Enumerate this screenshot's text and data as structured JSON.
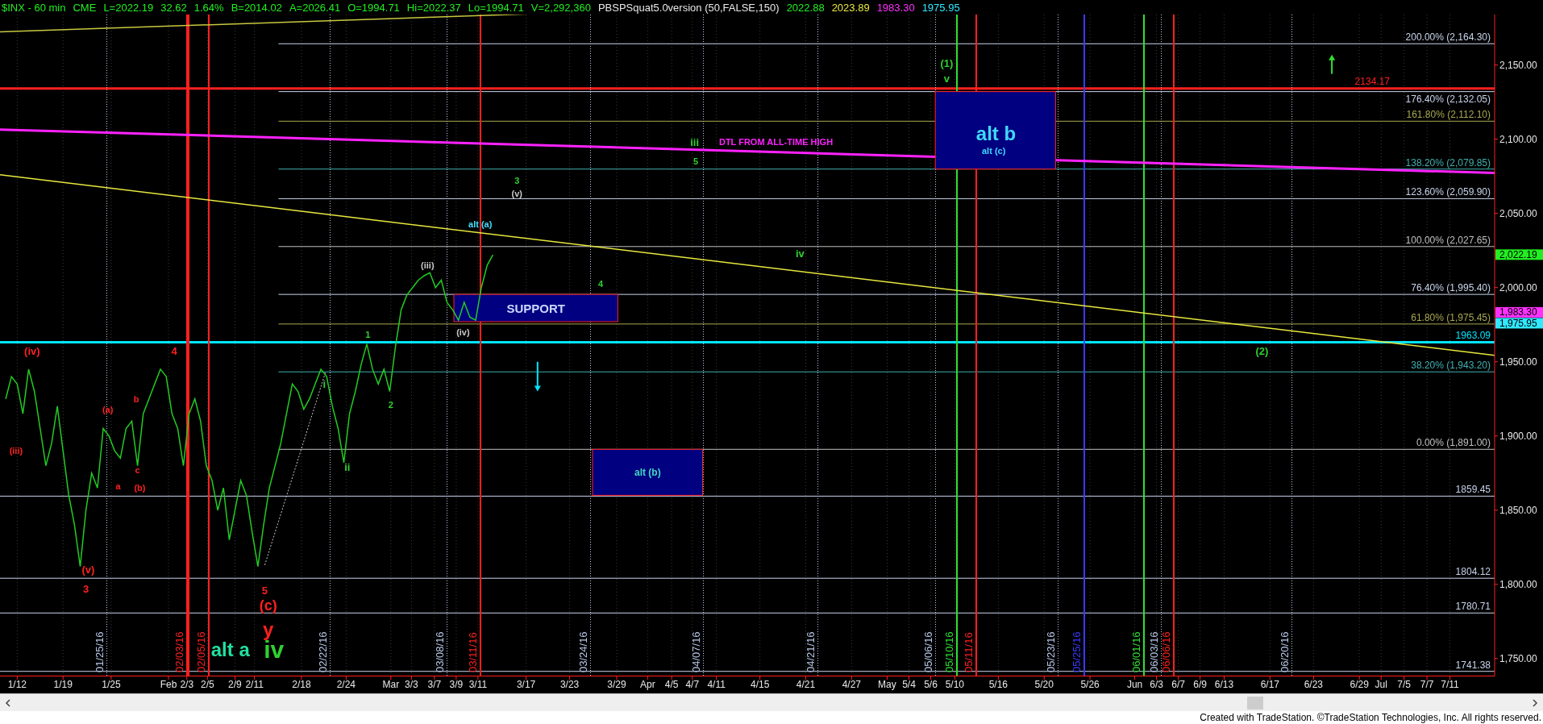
{
  "header": {
    "items": [
      {
        "text": "$INX - 60 min",
        "color": "#22ee22"
      },
      {
        "text": "CME",
        "color": "#22ee22"
      },
      {
        "text": "L=2022.19",
        "color": "#22ee22"
      },
      {
        "text": "32.62",
        "color": "#22ee22"
      },
      {
        "text": "1.64%",
        "color": "#22ee22"
      },
      {
        "text": "B=2014.02",
        "color": "#22ee22"
      },
      {
        "text": "A=2026.41",
        "color": "#22ee22"
      },
      {
        "text": "O=1994.71",
        "color": "#22ee22"
      },
      {
        "text": "Hi=2022.37",
        "color": "#22ee22"
      },
      {
        "text": "Lo=1994.71",
        "color": "#22ee22"
      },
      {
        "text": "V=2,292,360",
        "color": "#22ee22"
      },
      {
        "text": "PBSPSquat5.0version (50,FALSE,150)",
        "color": "#e8e8e8"
      },
      {
        "text": "2022.88",
        "color": "#22ee22"
      },
      {
        "text": "2023.89",
        "color": "#e8e840"
      },
      {
        "text": "1983.30",
        "color": "#ff30ff"
      },
      {
        "text": "1975.95",
        "color": "#30e8ff"
      }
    ]
  },
  "fib_levels": [
    {
      "text": "200.00% (2,164.30)",
      "color": "#c8d4ec"
    },
    {
      "text": "176.40% (2,132.05)",
      "color": "#c8d4ec"
    },
    {
      "text": "161.80% (2,112.10)",
      "color": "#a8a850"
    },
    {
      "text": "138.20% (2,079.85)",
      "color": "#40b0b0"
    },
    {
      "text": "123.60% (2,059.90)",
      "color": "#c8d4ec"
    },
    {
      "text": "100.00% (2,027.65)",
      "color": "#c0c0c0"
    },
    {
      "text": "76.40% (1,995.40)",
      "color": "#c8d4ec"
    },
    {
      "text": "61.80% (1,975.45)",
      "color": "#a8a850"
    },
    {
      "text": "38.20% (1,943.20)",
      "color": "#40b0b0"
    },
    {
      "text": "0.00% (1,891.00)",
      "color": "#c0c0c0"
    }
  ],
  "price_levels": [
    {
      "kind": "thick",
      "text": "2134.17",
      "color": "#ff2020"
    },
    {
      "kind": "thick",
      "text": "1963.09",
      "color": "#00e5ff"
    },
    {
      "kind": "thin",
      "text": "1859.45",
      "color": "#c8d4ec"
    },
    {
      "kind": "thin",
      "text": "1804.12",
      "color": "#c8d4ec"
    },
    {
      "kind": "thin",
      "text": "1780.71",
      "color": "#c8d4ec"
    },
    {
      "kind": "thin",
      "text": "1741.38",
      "color": "#c8d4ec"
    }
  ],
  "date_markers": [
    {
      "kind": "dotted",
      "text": "01/25/16",
      "color": "#b8c8e8"
    },
    {
      "kind": "thick",
      "text": "02/03/16",
      "color": "#ff2020"
    },
    {
      "kind": "solid",
      "text": "02/05/16",
      "color": "#ff2020"
    },
    {
      "kind": "dotted",
      "text": "02/22/16",
      "color": "#b8c8e8"
    },
    {
      "kind": "dotted",
      "text": "03/08/16",
      "color": "#b8c8e8"
    },
    {
      "kind": "solid",
      "text": "03/11/16",
      "color": "#ff2020"
    },
    {
      "kind": "dotted",
      "text": "03/24/16",
      "color": "#b8c8e8"
    },
    {
      "kind": "dotted",
      "text": "04/07/16",
      "color": "#b8c8e8"
    },
    {
      "kind": "dotted",
      "text": "04/21/16",
      "color": "#b8c8e8"
    },
    {
      "kind": "dotted",
      "text": "05/06/16",
      "color": "#b8c8e8"
    },
    {
      "kind": "solid",
      "text": "05/10/16",
      "color": "#30e030"
    },
    {
      "kind": "solid",
      "text": "05/11/16",
      "color": "#ff2020"
    },
    {
      "kind": "dotted",
      "text": "05/23/16",
      "color": "#b8c8e8"
    },
    {
      "kind": "solid",
      "text": "05/25/16",
      "color": "#3a3aff"
    },
    {
      "kind": "solid",
      "text": "06/01/16",
      "color": "#30e030"
    },
    {
      "kind": "dotted",
      "text": "06/03/16",
      "color": "#b8c8e8"
    },
    {
      "kind": "solid",
      "text": "06/06/16",
      "color": "#ff2020"
    },
    {
      "kind": "dotted",
      "text": "06/20/16",
      "color": "#b8c8e8"
    }
  ],
  "zones": [
    {
      "labels": [
        {
          "text": "SUPPORT",
          "color": "#c8d8ff"
        }
      ]
    },
    {
      "labels": [
        {
          "text": "alt (b)",
          "color": "#40d8c0"
        }
      ]
    },
    {
      "labels": [
        {
          "text": "alt b",
          "color": "#40d8ff"
        },
        {
          "text": "alt (c)",
          "color": "#40d8ff"
        }
      ]
    }
  ],
  "wave_labels": [
    {
      "text": "(iv)",
      "color": "#ff2020"
    },
    {
      "text": "4",
      "color": "#ff2020"
    },
    {
      "text": "(iii)",
      "color": "#ff2020"
    },
    {
      "text": "(a)",
      "color": "#ff2020"
    },
    {
      "text": "b",
      "color": "#ff2020"
    },
    {
      "text": "a",
      "color": "#ff2020"
    },
    {
      "text": "c",
      "color": "#ff2020"
    },
    {
      "text": "(b)",
      "color": "#ff2020"
    },
    {
      "text": "(v)",
      "color": "#ff2020"
    },
    {
      "text": "3",
      "color": "#ff2020"
    },
    {
      "text": "5",
      "color": "#ff2020"
    },
    {
      "text": "(c)",
      "color": "#ff2020"
    },
    {
      "text": "y",
      "color": "#ff2020"
    },
    {
      "text": "alt a",
      "color": "#20e0a0"
    },
    {
      "text": "iv",
      "color": "#30d030"
    },
    {
      "text": "i",
      "color": "#30d030"
    },
    {
      "text": "ii",
      "color": "#30d030"
    },
    {
      "text": "1",
      "color": "#30d030"
    },
    {
      "text": "2",
      "color": "#30d030"
    },
    {
      "text": "(iii)",
      "color": "#c8c8c8"
    },
    {
      "text": "(iv)",
      "color": "#c8c8c8"
    },
    {
      "text": "alt (a)",
      "color": "#40e0ff"
    },
    {
      "text": "3",
      "color": "#30d030"
    },
    {
      "text": "(v)",
      "color": "#c8c8c8"
    },
    {
      "text": "4",
      "color": "#30d030"
    },
    {
      "text": "iii",
      "color": "#30d030"
    },
    {
      "text": "DTL FROM ALL-TIME HIGH",
      "color": "#ff22ff"
    },
    {
      "text": "5",
      "color": "#30d030"
    },
    {
      "text": "iv",
      "color": "#30d030"
    },
    {
      "text": "(1)",
      "color": "#30d030"
    },
    {
      "text": "v",
      "color": "#30d030"
    },
    {
      "text": "(2)",
      "color": "#30d030"
    }
  ],
  "price_axis": {
    "labels": [
      "2,150.00",
      "2,100.00",
      "2,050.00",
      "2,000.00",
      "1,950.00",
      "1,900.00",
      "1,850.00",
      "1,800.00",
      "1,750.00"
    ]
  },
  "price_badges": [
    {
      "text": "2,022.19",
      "color": "#22ee22"
    },
    {
      "text": "1,983.30",
      "color": "#ff30ff"
    },
    {
      "text": "1,975.95",
      "color": "#30e8ff"
    }
  ],
  "date_axis": {
    "labels": [
      "1/12",
      "1/19",
      "1/25",
      "Feb",
      "2/3",
      "2/5",
      "2/9",
      "2/11",
      "2/18",
      "2/24",
      "Mar",
      "3/3",
      "3/7",
      "3/9",
      "3/11",
      "3/17",
      "3/23",
      "3/29",
      "Apr",
      "4/5",
      "4/7",
      "4/11",
      "4/15",
      "4/21",
      "4/27",
      "May",
      "5/4",
      "5/6",
      "5/10",
      "5/16",
      "5/20",
      "5/26",
      "Jun",
      "6/3",
      "6/7",
      "6/9",
      "6/13",
      "6/17",
      "6/23",
      "6/29",
      "Jul",
      "7/5",
      "7/7",
      "7/11"
    ]
  },
  "footer": {
    "text": "Created with TradeStation. ©TradeStation Technologies, Inc. All rights reserved."
  }
}
